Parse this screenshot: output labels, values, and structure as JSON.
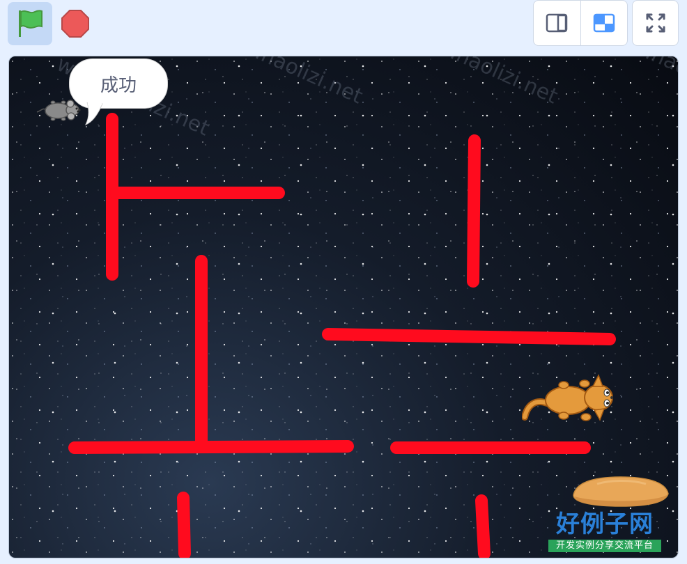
{
  "toolbar": {
    "green_flag_icon": "green-flag-icon",
    "stop_icon": "stop-sign-icon",
    "small_stage_icon": "small-stage-icon",
    "normal_stage_icon": "normal-stage-icon",
    "fullscreen_icon": "fullscreen-icon"
  },
  "stage": {
    "speech_text": "成功",
    "watermark_big": "好例子网",
    "watermark_small": "开发实例分享交流平台",
    "watermark_diag": "www.haolizi.net"
  },
  "colors": {
    "wall": "#ff0b1e",
    "flag": "#4cbf56",
    "stop": "#ec5959",
    "active_mode": "#4c97ff"
  }
}
